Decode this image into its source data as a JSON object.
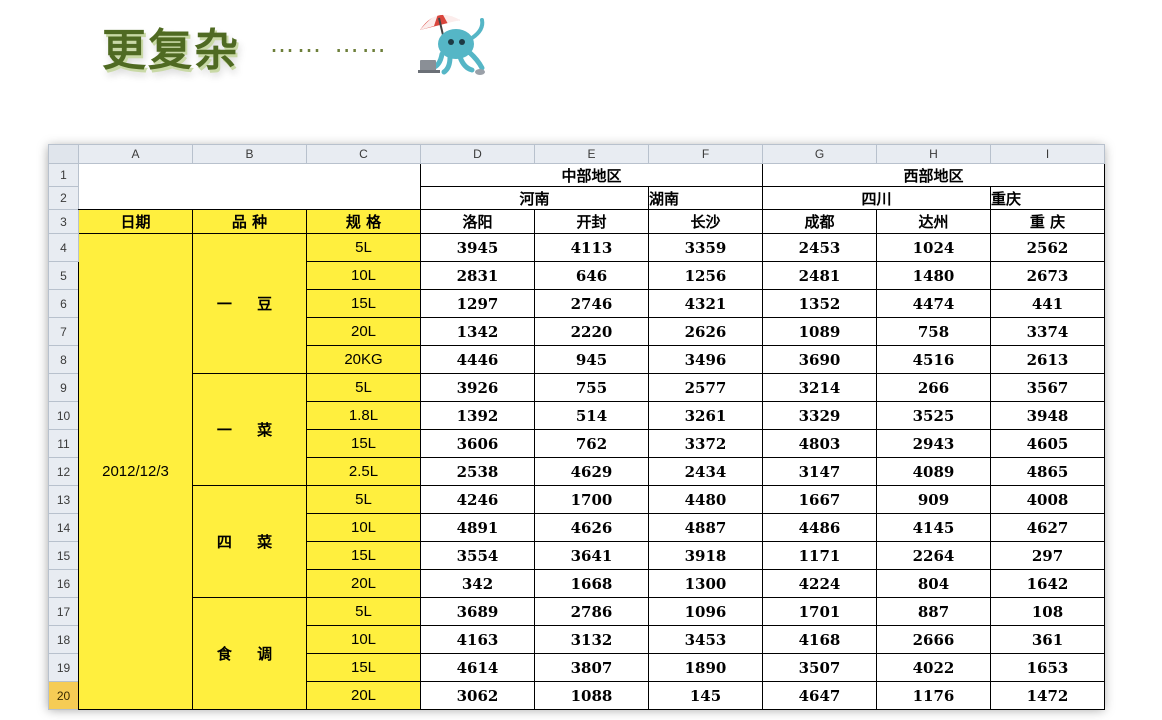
{
  "title": "更复杂",
  "title_dots": "…… ……",
  "sheet": {
    "column_letters": [
      "A",
      "B",
      "C",
      "D",
      "E",
      "F",
      "G",
      "H",
      "I"
    ],
    "row_numbers": [
      "1",
      "2",
      "3",
      "4",
      "5",
      "6",
      "7",
      "8",
      "9",
      "10",
      "11",
      "12",
      "13",
      "14",
      "15",
      "16",
      "17",
      "18",
      "19",
      "20"
    ],
    "region_central": "中部地区",
    "region_west": "西部地区",
    "prov_henan": "河南",
    "prov_hunan": "湖南",
    "prov_sichuan": "四川",
    "prov_chongqing": "重庆",
    "hdr_date": "日期",
    "hdr_variety": "品 种",
    "hdr_spec": "规 格",
    "cities": [
      "洛阳",
      "开封",
      "长沙",
      "成都",
      "达州",
      "重 庆"
    ],
    "date": "2012/12/3",
    "groups": [
      {
        "name": "一 豆",
        "rows": [
          {
            "spec": "5L",
            "values": [
              "3945",
              "4113",
              "3359",
              "2453",
              "1024",
              "2562"
            ]
          },
          {
            "spec": "10L",
            "values": [
              "2831",
              "646",
              "1256",
              "2481",
              "1480",
              "2673"
            ]
          },
          {
            "spec": "15L",
            "values": [
              "1297",
              "2746",
              "4321",
              "1352",
              "4474",
              "441"
            ]
          },
          {
            "spec": "20L",
            "values": [
              "1342",
              "2220",
              "2626",
              "1089",
              "758",
              "3374"
            ]
          },
          {
            "spec": "20KG",
            "values": [
              "4446",
              "945",
              "3496",
              "3690",
              "4516",
              "2613"
            ]
          }
        ]
      },
      {
        "name": "一 菜",
        "rows": [
          {
            "spec": "5L",
            "values": [
              "3926",
              "755",
              "2577",
              "3214",
              "266",
              "3567"
            ]
          },
          {
            "spec": "1.8L",
            "values": [
              "1392",
              "514",
              "3261",
              "3329",
              "3525",
              "3948"
            ]
          },
          {
            "spec": "15L",
            "values": [
              "3606",
              "762",
              "3372",
              "4803",
              "2943",
              "4605"
            ]
          },
          {
            "spec": "2.5L",
            "values": [
              "2538",
              "4629",
              "2434",
              "3147",
              "4089",
              "4865"
            ]
          }
        ]
      },
      {
        "name": "四 菜",
        "rows": [
          {
            "spec": "5L",
            "values": [
              "4246",
              "1700",
              "4480",
              "1667",
              "909",
              "4008"
            ]
          },
          {
            "spec": "10L",
            "values": [
              "4891",
              "4626",
              "4887",
              "4486",
              "4145",
              "4627"
            ]
          },
          {
            "spec": "15L",
            "values": [
              "3554",
              "3641",
              "3918",
              "1171",
              "2264",
              "297"
            ]
          },
          {
            "spec": "20L",
            "values": [
              "342",
              "1668",
              "1300",
              "4224",
              "804",
              "1642"
            ]
          }
        ]
      },
      {
        "name": "食 调",
        "rows": [
          {
            "spec": "5L",
            "values": [
              "3689",
              "2786",
              "1096",
              "1701",
              "887",
              "108"
            ]
          },
          {
            "spec": "10L",
            "values": [
              "4163",
              "3132",
              "3453",
              "4168",
              "2666",
              "361"
            ]
          },
          {
            "spec": "15L",
            "values": [
              "4614",
              "3807",
              "1890",
              "3507",
              "4022",
              "1653"
            ]
          },
          {
            "spec": "20L",
            "values": [
              "3062",
              "1088",
              "145",
              "4647",
              "1176",
              "1472"
            ]
          }
        ]
      }
    ],
    "selected_row": "20",
    "colors": {
      "yellow_fill": "#ffef3e",
      "header_bg": "#e8ecf2",
      "selected_row_header": "#f6cc55",
      "title_green": "#4f6a22"
    }
  },
  "icons": [
    "umbrella-octopus-mascot"
  ]
}
